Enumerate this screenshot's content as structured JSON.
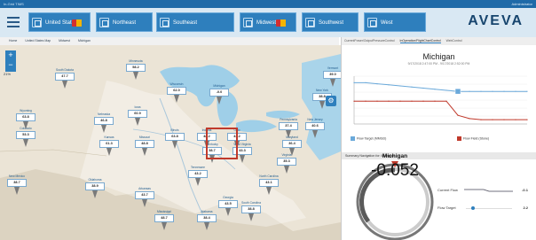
{
  "app": {
    "title": "In-Grid TIMS",
    "user": "Administrator"
  },
  "nav": {
    "regions": [
      {
        "label": "United States",
        "flag": true
      },
      {
        "label": "Northeast",
        "flag": false
      },
      {
        "label": "Southeast",
        "flag": false
      },
      {
        "label": "Midwest",
        "flag": true
      },
      {
        "label": "Southwest",
        "flag": false
      },
      {
        "label": "West",
        "flag": false
      }
    ],
    "logo": "AVEVA"
  },
  "breadcrumb": [
    "Home",
    "United States Map",
    "Midwest",
    "Michigan"
  ],
  "map": {
    "zoom_label": "21%",
    "pins": [
      {
        "name": "Minnesota",
        "value": "58.2"
      },
      {
        "name": "South Dakota",
        "value": "47.7"
      },
      {
        "name": "Wisconsin",
        "value": "62.0"
      },
      {
        "name": "Michigan",
        "value": "-0.0"
      },
      {
        "name": "New York",
        "value": "38.8"
      },
      {
        "name": "Vermont",
        "value": "39.0"
      },
      {
        "name": "Wyoming",
        "value": "63.8"
      },
      {
        "name": "Nebraska",
        "value": "46.8"
      },
      {
        "name": "Iowa",
        "value": "60.9"
      },
      {
        "name": "Colorado",
        "value": "53.3"
      },
      {
        "name": "Illinois",
        "value": "63.8"
      },
      {
        "name": "Indiana",
        "value": "48.2"
      },
      {
        "name": "Ohio",
        "value": "43.2"
      },
      {
        "name": "Pennsylvania",
        "value": "37.4"
      },
      {
        "name": "New Jersey",
        "value": "40.6"
      },
      {
        "name": "Kansas",
        "value": "61.3"
      },
      {
        "name": "Missouri",
        "value": "48.8"
      },
      {
        "name": "Kentucky",
        "value": "38.7"
      },
      {
        "name": "West Virginia",
        "value": "43.3"
      },
      {
        "name": "Maryland",
        "value": "36.4"
      },
      {
        "name": "Virginia",
        "value": "35.3"
      },
      {
        "name": "New Mexico",
        "value": "38.7"
      },
      {
        "name": "Oklahoma",
        "value": "38.9"
      },
      {
        "name": "Tennessee",
        "value": "43.2"
      },
      {
        "name": "North Carolina",
        "value": "43.1"
      },
      {
        "name": "Arkansas",
        "value": "43.7"
      },
      {
        "name": "Georgia",
        "value": "43.5"
      },
      {
        "name": "South Carolina",
        "value": "38.8"
      },
      {
        "name": "Mississippi",
        "value": "48.7"
      },
      {
        "name": "Alabama",
        "value": "38.4"
      }
    ]
  },
  "right": {
    "tabs": [
      "CurrentPower/OutputPressureControl",
      "InOperation/FlightChartControl",
      "WebControl"
    ],
    "active_tab": 1,
    "chart_title": "Michigan",
    "chart_subtitle": "9/17/2018 2:47:00 PM - 9/17/2018 2:52:00 PM",
    "legend": [
      "Flow Target (MMGD)",
      "Flow Field (Stone)"
    ],
    "summary_header": "Summary Navigation for: Michigan",
    "gauge_label": "Michigan",
    "gauge_value": "-0.052",
    "rows": [
      {
        "label": "Current Flow",
        "value": "-0.1"
      },
      {
        "label": "Flow Target",
        "value": "2.2"
      }
    ]
  },
  "colors": {
    "accent": "#2e7fbd",
    "series_target": "#6aa9da",
    "series_field": "#c0392b"
  },
  "chart_data": {
    "type": "line",
    "title": "Michigan",
    "series": [
      {
        "name": "Flow Target (MMGD)",
        "values": [
          1.8,
          1.8,
          1.7,
          1.6,
          1.5,
          1.4,
          1.3,
          1.2,
          1.1,
          1.0,
          1.0,
          1.0,
          1.0,
          1.0,
          1.0,
          1.0
        ]
      },
      {
        "name": "Flow Field (Stone)",
        "values": [
          0.1,
          0.1,
          0.1,
          0.1,
          0.1,
          0.1,
          0.1,
          0.1,
          0.1,
          -1.2,
          -1.5,
          -1.6,
          -1.6,
          -1.6,
          -1.6,
          -1.6
        ]
      }
    ],
    "ylim": [
      -2,
      2.4
    ]
  }
}
